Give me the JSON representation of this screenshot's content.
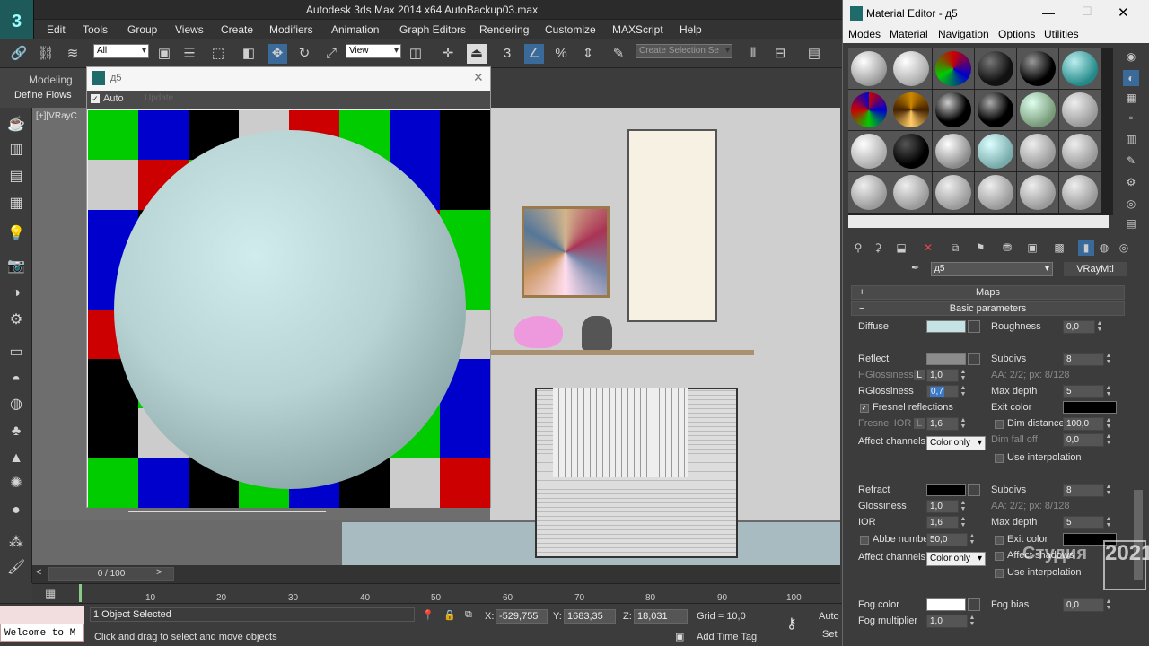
{
  "app": {
    "title": "Autodesk 3ds Max  2014 x64     AutoBackup03.max",
    "logo": "3ds-max-logo-icon"
  },
  "menu": [
    "Edit",
    "Tools",
    "Group",
    "Views",
    "Create",
    "Modifiers",
    "Animation",
    "Graph Editors",
    "Rendering",
    "Customize",
    "MAXScript",
    "Help"
  ],
  "toolbar": {
    "filter": "All",
    "refcoord": "View",
    "selection_set_placeholder": "Create Selection Se"
  },
  "ribbon": {
    "tab": "Modeling",
    "sub": "Define Flows"
  },
  "viewport": {
    "label": "[+][VRayC"
  },
  "preview": {
    "title": "д5",
    "auto_label": "Auto",
    "update_label": "Update"
  },
  "checker_colors": [
    "#00cc00",
    "#0000cc",
    "#000000",
    "#cccccc",
    "#cc0000",
    "#00cc00",
    "#0000cc",
    "#000000"
  ],
  "timeline": {
    "frame_label": "0 / 100",
    "ticks": [
      "10",
      "20",
      "30",
      "40",
      "50",
      "60",
      "70",
      "80",
      "90",
      "100"
    ]
  },
  "status": {
    "welcome": "Welcome to M",
    "selected": "1 Object Selected",
    "prompt": "Click and drag to select and move objects",
    "x_label": "X:",
    "x_value": "-529,755",
    "y_label": "Y:",
    "y_value": "1683,35",
    "z_label": "Z:",
    "z_value": "18,031",
    "grid": "Grid = 10,0",
    "add_time_tag": "Add Time Tag",
    "auto": "Auto",
    "set": "Set"
  },
  "material_editor": {
    "title": "Material Editor - д5",
    "menu": [
      "Modes",
      "Material",
      "Navigation",
      "Options",
      "Utilities"
    ],
    "material_name": "д5",
    "material_type": "VRayMtl",
    "maps_label": "Maps",
    "basic_label": "Basic parameters",
    "diffuse": {
      "label": "Diffuse",
      "color": "#c6e3e3",
      "roughness_label": "Roughness",
      "roughness": "0,0"
    },
    "reflect": {
      "label": "Reflect",
      "color": "#8c8c8c",
      "hgloss_label": "HGlossiness",
      "hgloss": "1,0",
      "l": "L",
      "rgloss_label": "RGlossiness",
      "rgloss": "0,7",
      "fresnel_label": "Fresnel reflections",
      "fresnel_ior_label": "Fresnel IOR",
      "fresnel_ior": "1,6",
      "affect_label": "Affect channels",
      "affect_value": "Color only",
      "subdivs_label": "Subdivs",
      "subdivs": "8",
      "aa": "AA: 2/2; px: 8/128",
      "maxdepth_label": "Max depth",
      "maxdepth": "5",
      "exit_label": "Exit color",
      "dim_label": "Dim distance",
      "dim_value": "100,0",
      "dimfall_label": "Dim fall off",
      "dimfall_value": "0,0",
      "interp_label": "Use interpolation"
    },
    "refract": {
      "label": "Refract",
      "color": "#000000",
      "gloss_label": "Glossiness",
      "gloss": "1,0",
      "ior_label": "IOR",
      "ior": "1,6",
      "abbe_label": "Abbe number",
      "abbe": "50,0",
      "affect_label": "Affect channels",
      "affect_value": "Color only",
      "subdivs_label": "Subdivs",
      "subdivs": "8",
      "aa": "AA: 2/2; px: 8/128",
      "maxdepth_label": "Max depth",
      "maxdepth": "5",
      "exit_label": "Exit color",
      "affect_shadows_label": "Affect shadows",
      "interp_label": "Use interpolation"
    },
    "fog": {
      "color_label": "Fog color",
      "color": "#ffffff",
      "multiplier_label": "Fog multiplier",
      "multiplier": "1,0",
      "bias_label": "Fog bias",
      "bias": "0,0"
    },
    "watermark": {
      "text": "Студия",
      "num": "2021"
    }
  }
}
